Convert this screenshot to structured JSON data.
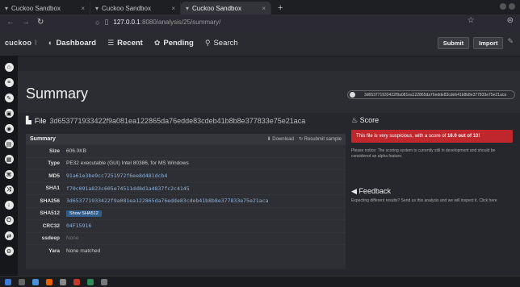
{
  "browser": {
    "tabs": [
      {
        "label": "Cuckoo Sandbox"
      },
      {
        "label": "Cuckoo Sandbox"
      },
      {
        "label": "Cuckoo Sandbox"
      }
    ],
    "url_host": "127.0.0.1",
    "url_path": ":8080/analysis/25/summary/"
  },
  "header": {
    "logo": "cuckoo",
    "menu": [
      {
        "label": "Dashboard"
      },
      {
        "label": "Recent"
      },
      {
        "label": "Pending"
      },
      {
        "label": "Search"
      }
    ],
    "submit_label": "Submit",
    "import_label": "Import"
  },
  "summary": {
    "title": "Summary",
    "hash_badge": "3d653771933422f9a081ea122865da76edde83cdeb41b8b8e377833e75e21aca"
  },
  "file": {
    "heading_prefix": "File",
    "filename": "3d653771933422f9a081ea122865da76edde83cdeb41b8b8e377833e75e21aca",
    "table_title": "Summary",
    "download_label": "Download",
    "resubmit_label": "Resubmit sample",
    "rows": [
      {
        "key": "Size",
        "value": "606.0KB"
      },
      {
        "key": "Type",
        "value": "PE32 executable (GUI) Intel 80386, for MS Windows"
      },
      {
        "key": "MD5",
        "value": "91a61e3be9cc7251972f6ee8d481dcb4"
      },
      {
        "key": "SHA1",
        "value": "f70c091a823c605e74511dd8d1a4837fc2c4145"
      },
      {
        "key": "SHA256",
        "value": "3d653771933422f9a081ea122865da76edde83cdeb41b8b8e377833e75e21aca"
      },
      {
        "key": "SHA512",
        "value": "Show SHA512"
      },
      {
        "key": "CRC32",
        "value": "04F15916"
      },
      {
        "key": "ssdeep",
        "value": "None"
      },
      {
        "key": "Yara",
        "value": "None matched"
      }
    ]
  },
  "score": {
    "title": "Score",
    "alert_prefix": "This file is very suspicious, with a score of ",
    "alert_score": "16.0 out of 10!",
    "note": "Please notice: The scoring system is currently still in development and should be considered an alpha feature."
  },
  "feedback": {
    "title": "Feedback",
    "text": "Expecting different results? Send us this analysis and we will inspect it. Click here"
  }
}
